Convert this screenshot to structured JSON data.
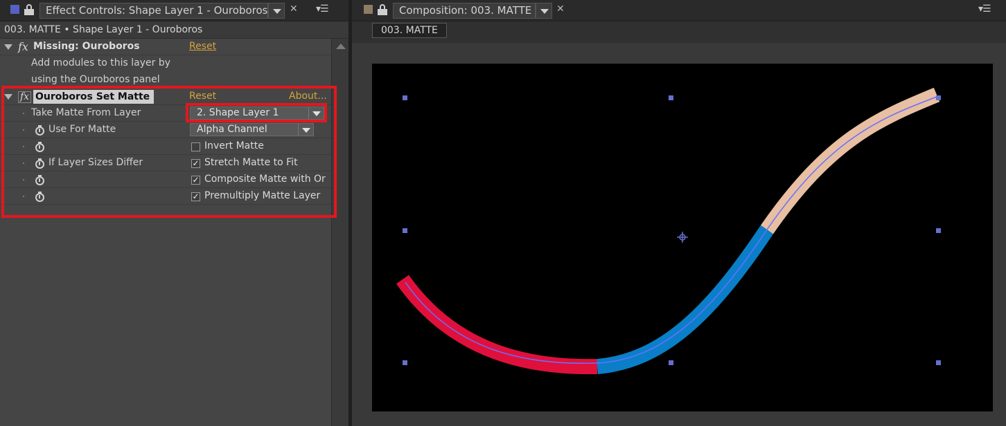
{
  "left_panel": {
    "tab_title": "Effect Controls: Shape Layer 1 - Ouroboros",
    "breadcrumb": "003. MATTE • Shape Layer 1 - Ouroboros",
    "tab_color": "#5661c4",
    "missing_effect": {
      "name": "Missing: Ouroboros",
      "reset": "Reset",
      "message_line1": "Add modules to this layer by",
      "message_line2": "using the Ouroboros panel"
    },
    "set_matte_effect": {
      "name": "Ouroboros Set Matte",
      "reset": "Reset",
      "about": "About...",
      "properties": [
        {
          "label": "Take Matte From Layer",
          "type": "dropdown",
          "value": "2. Shape Layer 1"
        },
        {
          "label": "Use For Matte",
          "type": "dropdown",
          "value": "Alpha Channel"
        },
        {
          "label": "",
          "type": "checkbox",
          "checked": false,
          "text": "Invert Matte"
        },
        {
          "label": "If Layer Sizes Differ",
          "type": "checkbox",
          "checked": true,
          "text": "Stretch Matte to Fit"
        },
        {
          "label": "",
          "type": "checkbox",
          "checked": true,
          "text": "Composite Matte with Or"
        },
        {
          "label": "",
          "type": "checkbox",
          "checked": true,
          "text": "Premultiply Matte Layer"
        }
      ]
    }
  },
  "right_panel": {
    "tab_title": "Composition: 003. MATTE",
    "tab_color": "#8e7c64",
    "comp_tab_label": "003. MATTE",
    "stroke_colors": {
      "red": "#e0103c",
      "blue": "#0a7fc8",
      "peach": "#e8bfa2",
      "path": "#6670ff",
      "handle": "#6670cc"
    }
  },
  "icons": {
    "menu": "panel-menu-icon",
    "close": "close-icon",
    "lock": "lock-icon",
    "stopwatch": "stopwatch-icon"
  }
}
